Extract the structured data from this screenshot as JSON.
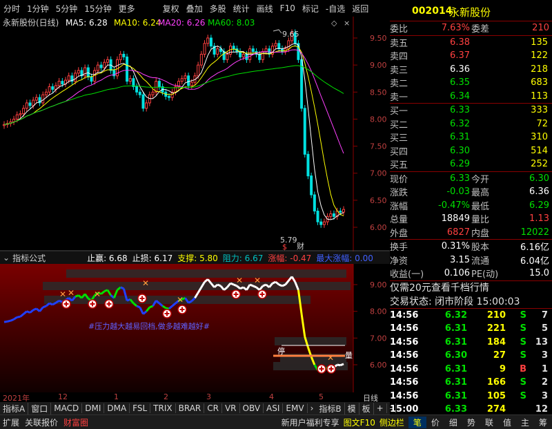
{
  "toolbar": {
    "items": [
      "分时",
      "1分钟",
      "5分钟",
      "15分钟",
      "更多",
      "复权",
      "叠加",
      "多股",
      "统计",
      "画线",
      "F10",
      "标记",
      "-自选",
      "返回"
    ]
  },
  "stock": {
    "code": "002014",
    "name": "永新股份"
  },
  "main": {
    "title": "永新股份(日线)",
    "ma": [
      {
        "label": "MA5: 6.28",
        "color": "#ffffff"
      },
      {
        "label": "MA10: 6.24",
        "color": "#ffff00"
      },
      {
        "label": "MA20: 6.26",
        "color": "#ff40ff"
      },
      {
        "label": "MA60: 8.03",
        "color": "#00e000"
      }
    ],
    "high_label": "9.65",
    "low_label": "5.79",
    "mark_s": "$",
    "mark_cai": "财",
    "yticks": [
      "9.50",
      "9.00",
      "8.50",
      "8.00",
      "7.50",
      "7.00",
      "6.50",
      "6.00"
    ]
  },
  "indicator": {
    "name": "指标公式",
    "stats": [
      {
        "t": "止赢: 6.68",
        "c": "#ffffff"
      },
      {
        "t": "止损: 6.17",
        "c": "#ffffff"
      },
      {
        "t": "支撑: 5.80",
        "c": "#ffff00"
      },
      {
        "t": "阻力: 6.67",
        "c": "#00c0c0"
      },
      {
        "t": "涨幅: -0.47",
        "c": "#ff4040"
      },
      {
        "t": "最大涨幅: 0.00",
        "c": "#4060ff"
      }
    ],
    "note": "#压力越大越易回档,做多越难越好#",
    "stop_label": "停",
    "liang_label": "量",
    "yticks": [
      "9.00",
      "8.00",
      "7.00",
      "6.00"
    ]
  },
  "dates": {
    "year": "2021年",
    "months": [
      "12",
      "1",
      "2",
      "3",
      "4",
      "5"
    ],
    "right": "日线"
  },
  "tabs": [
    "指标A",
    "窗口",
    "MACD",
    "DMI",
    "DMA",
    "FSL",
    "TRIX",
    "BRAR",
    "CR",
    "VR",
    "OBV",
    "ASI",
    "EMV",
    "指标B",
    "模",
    "板",
    "+",
    "-"
  ],
  "bottom": {
    "left": [
      "扩展",
      "关联报价",
      "财富圈"
    ],
    "promo": "新用户福利专享",
    "f10": "图文F10",
    "side": "侧边栏",
    "nav": [
      "笔",
      "价",
      "细",
      "势",
      "联",
      "值",
      "主",
      "筹"
    ]
  },
  "quote": {
    "weibi_label": "委比",
    "weibi": "7.63%",
    "weicha_label": "委差",
    "weicha": "210",
    "asks": [
      {
        "l": "卖五",
        "p": "6.38",
        "v": "135",
        "pc": "#ff4040"
      },
      {
        "l": "卖四",
        "p": "6.37",
        "v": "122",
        "pc": "#ff4040"
      },
      {
        "l": "卖三",
        "p": "6.36",
        "v": "218",
        "pc": "#ffffff"
      },
      {
        "l": "卖二",
        "p": "6.35",
        "v": "683",
        "pc": "#00e000"
      },
      {
        "l": "卖一",
        "p": "6.34",
        "v": "113",
        "pc": "#00e000"
      }
    ],
    "bids": [
      {
        "l": "买一",
        "p": "6.33",
        "v": "333",
        "pc": "#00e000"
      },
      {
        "l": "买二",
        "p": "6.32",
        "v": "72",
        "pc": "#00e000"
      },
      {
        "l": "买三",
        "p": "6.31",
        "v": "310",
        "pc": "#00e000"
      },
      {
        "l": "买四",
        "p": "6.30",
        "v": "514",
        "pc": "#00e000"
      },
      {
        "l": "买五",
        "p": "6.29",
        "v": "252",
        "pc": "#00e000"
      }
    ],
    "stats": [
      {
        "l1": "现价",
        "v1": "6.33",
        "c1": "#00e000",
        "l2": "今开",
        "v2": "6.30",
        "c2": "#00e000"
      },
      {
        "l1": "涨跌",
        "v1": "-0.03",
        "c1": "#00e000",
        "l2": "最高",
        "v2": "6.36",
        "c2": "#ffffff"
      },
      {
        "l1": "涨幅",
        "v1": "-0.47%",
        "c1": "#00e000",
        "l2": "最低",
        "v2": "6.29",
        "c2": "#00e000"
      },
      {
        "l1": "总量",
        "v1": "18849",
        "c1": "#ffffff",
        "l2": "量比",
        "v2": "1.13",
        "c2": "#ff4040"
      },
      {
        "l1": "外盘",
        "v1": "6827",
        "c1": "#ff4040",
        "l2": "内盘",
        "v2": "12022",
        "c2": "#00e000"
      }
    ],
    "stats2": [
      {
        "l1": "换手",
        "v1": "0.31%",
        "l2": "股本",
        "v2": "6.16亿"
      },
      {
        "l1": "净资",
        "v1": "3.15",
        "l2": "流通",
        "v2": "6.04亿"
      },
      {
        "l1": "收益(一)",
        "v1": "0.106",
        "l2": "PE(动)",
        "v2": "15.0"
      }
    ],
    "promo": "仅需20元查看千档行情",
    "status": "交易状态: 闭市阶段 15:00:03",
    "ticks": [
      {
        "t": "14:56",
        "p": "6.32",
        "pc": "#00e000",
        "v": "210",
        "bs": "S",
        "n": "7"
      },
      {
        "t": "14:56",
        "p": "6.31",
        "pc": "#00e000",
        "v": "221",
        "bs": "S",
        "n": "5"
      },
      {
        "t": "14:56",
        "p": "6.31",
        "pc": "#00e000",
        "v": "184",
        "bs": "S",
        "n": "13"
      },
      {
        "t": "14:56",
        "p": "6.30",
        "pc": "#00e000",
        "v": "27",
        "bs": "S",
        "n": "3"
      },
      {
        "t": "14:56",
        "p": "6.31",
        "pc": "#00e000",
        "v": "9",
        "bs": "B",
        "n": "1"
      },
      {
        "t": "14:56",
        "p": "6.31",
        "pc": "#00e000",
        "v": "166",
        "bs": "S",
        "n": "2"
      },
      {
        "t": "14:56",
        "p": "6.31",
        "pc": "#00e000",
        "v": "105",
        "bs": "S",
        "n": "3"
      },
      {
        "t": "15:00",
        "p": "6.33",
        "pc": "#00e000",
        "v": "274",
        "bs": "",
        "n": "12"
      }
    ]
  }
}
